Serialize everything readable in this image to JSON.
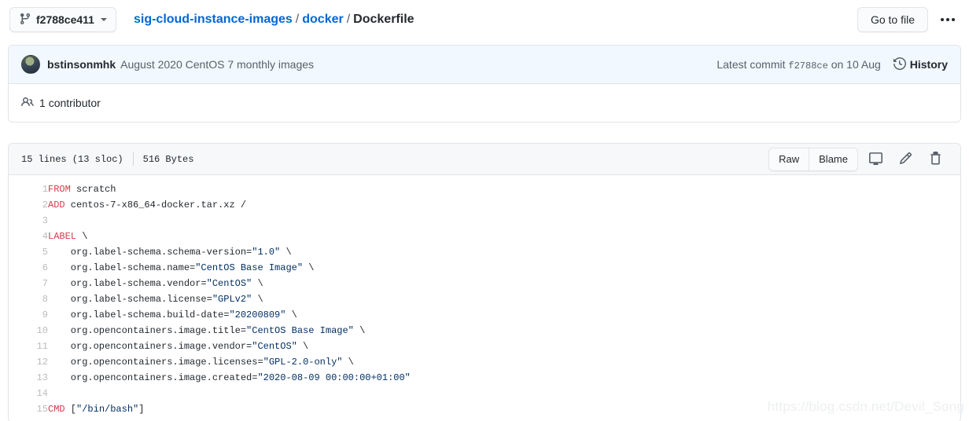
{
  "topbar": {
    "branch": {
      "icon": "git-branch-icon",
      "label": "f2788ce411",
      "caret": "chevron-down-icon"
    },
    "breadcrumb": {
      "repo": "sig-cloud-instance-images",
      "folder": "docker",
      "file": "Dockerfile",
      "separator": "/"
    },
    "go_to_file_label": "Go to file",
    "kebab": "kebab-menu-icon"
  },
  "commit": {
    "avatar": "user-avatar",
    "author": "bstinsonmhk",
    "message": "August 2020 CentOS 7 monthly images",
    "latest_commit_prefix": "Latest commit",
    "latest_commit_sha": "f2788ce",
    "latest_commit_date": "on 10 Aug",
    "history_label": "History",
    "history_icon": "history-clock-icon"
  },
  "contributors": {
    "icon": "people-icon",
    "count": "1",
    "label": "contributor"
  },
  "file_header": {
    "lines": "15 lines (13 sloc)",
    "size": "516 Bytes",
    "raw_label": "Raw",
    "blame_label": "Blame",
    "desktop_icon": "open-in-desktop-icon",
    "edit_icon": "pencil-edit-icon",
    "delete_icon": "trash-delete-icon"
  },
  "code": {
    "language": "dockerfile",
    "lines": [
      {
        "n": "1",
        "tokens": [
          {
            "t": "k",
            "v": "FROM"
          },
          {
            "t": "p",
            "v": " scratch"
          }
        ]
      },
      {
        "n": "2",
        "tokens": [
          {
            "t": "k",
            "v": "ADD"
          },
          {
            "t": "p",
            "v": " centos-7-x86_64-docker.tar.xz /"
          }
        ]
      },
      {
        "n": "3",
        "tokens": []
      },
      {
        "n": "4",
        "tokens": [
          {
            "t": "k",
            "v": "LABEL"
          },
          {
            "t": "p",
            "v": " \\"
          }
        ]
      },
      {
        "n": "5",
        "tokens": [
          {
            "t": "p",
            "v": "    org.label-schema.schema-version="
          },
          {
            "t": "s",
            "v": "\"1.0\""
          },
          {
            "t": "p",
            "v": " \\"
          }
        ]
      },
      {
        "n": "6",
        "tokens": [
          {
            "t": "p",
            "v": "    org.label-schema.name="
          },
          {
            "t": "s",
            "v": "\"CentOS Base Image\""
          },
          {
            "t": "p",
            "v": " \\"
          }
        ]
      },
      {
        "n": "7",
        "tokens": [
          {
            "t": "p",
            "v": "    org.label-schema.vendor="
          },
          {
            "t": "s",
            "v": "\"CentOS\""
          },
          {
            "t": "p",
            "v": " \\"
          }
        ]
      },
      {
        "n": "8",
        "tokens": [
          {
            "t": "p",
            "v": "    org.label-schema.license="
          },
          {
            "t": "s",
            "v": "\"GPLv2\""
          },
          {
            "t": "p",
            "v": " \\"
          }
        ]
      },
      {
        "n": "9",
        "tokens": [
          {
            "t": "p",
            "v": "    org.label-schema.build-date="
          },
          {
            "t": "s",
            "v": "\"20200809\""
          },
          {
            "t": "p",
            "v": " \\"
          }
        ]
      },
      {
        "n": "10",
        "tokens": [
          {
            "t": "p",
            "v": "    org.opencontainers.image.title="
          },
          {
            "t": "s",
            "v": "\"CentOS Base Image\""
          },
          {
            "t": "p",
            "v": " \\"
          }
        ]
      },
      {
        "n": "11",
        "tokens": [
          {
            "t": "p",
            "v": "    org.opencontainers.image.vendor="
          },
          {
            "t": "s",
            "v": "\"CentOS\""
          },
          {
            "t": "p",
            "v": " \\"
          }
        ]
      },
      {
        "n": "12",
        "tokens": [
          {
            "t": "p",
            "v": "    org.opencontainers.image.licenses="
          },
          {
            "t": "s",
            "v": "\"GPL-2.0-only\""
          },
          {
            "t": "p",
            "v": " \\"
          }
        ]
      },
      {
        "n": "13",
        "tokens": [
          {
            "t": "p",
            "v": "    org.opencontainers.image.created="
          },
          {
            "t": "s",
            "v": "\"2020-08-09 00:00:00+01:00\""
          }
        ]
      },
      {
        "n": "14",
        "tokens": []
      },
      {
        "n": "15",
        "tokens": [
          {
            "t": "k",
            "v": "CMD"
          },
          {
            "t": "p",
            "v": " ["
          },
          {
            "t": "s",
            "v": "\"/bin/bash\""
          },
          {
            "t": "p",
            "v": "]"
          }
        ]
      }
    ]
  },
  "watermark": "https://blog.csdn.net/Devil_Song",
  "colors": {
    "link": "#0366d6",
    "text": "#24292e",
    "muted": "#586069",
    "border": "#e1e4e8",
    "commit_bar_bg": "#f1f8ff",
    "file_header_bg": "#f6f8fa",
    "keyword": "#d73a49",
    "string": "#032f62",
    "line_number": "#babbbd"
  }
}
